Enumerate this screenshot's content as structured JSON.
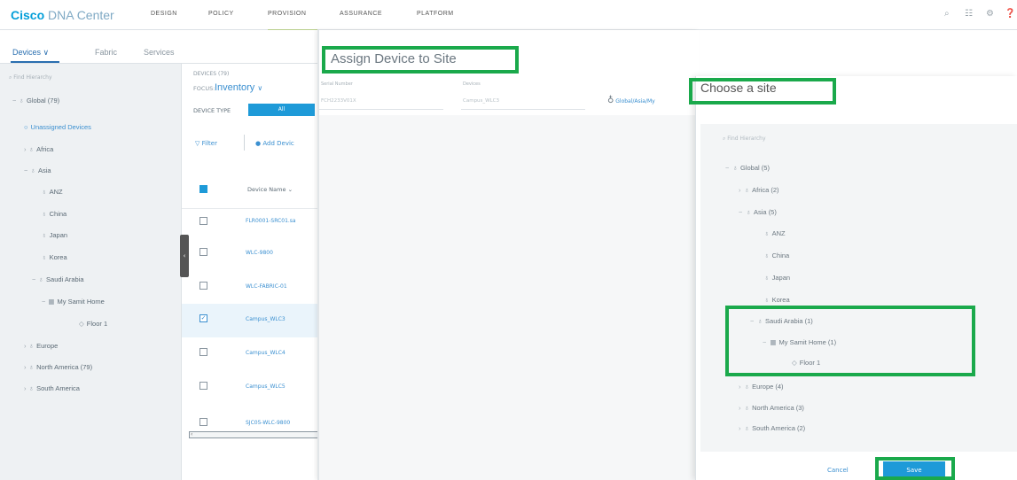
{
  "header": {
    "logo_bold": "Cisco",
    "logo_light": "DNA Center",
    "nav": [
      "DESIGN",
      "POLICY",
      "PROVISION",
      "ASSURANCE",
      "PLATFORM"
    ],
    "active_nav": "PROVISION",
    "icons": [
      "search-icon",
      "apps-icon",
      "gear-icon",
      "help-icon"
    ]
  },
  "subnav": {
    "tabs": [
      "Devices",
      "Fabric",
      "Services"
    ],
    "active": "Devices"
  },
  "sidebar": {
    "search_placeholder": "Find Hierarchy",
    "tree": [
      {
        "label": "Global (79)",
        "chev": "−",
        "icon": "globe-icon"
      },
      {
        "label": "Unassigned Devices",
        "icon": "unassigned-icon",
        "accent": true
      },
      {
        "label": "Africa",
        "chev": "›",
        "icon": "site-icon"
      },
      {
        "label": "Asia",
        "chev": "−",
        "icon": "site-icon"
      },
      {
        "label": "ANZ",
        "icon": "site-icon"
      },
      {
        "label": "China",
        "icon": "site-icon"
      },
      {
        "label": "Japan",
        "icon": "site-icon"
      },
      {
        "label": "Korea",
        "icon": "site-icon"
      },
      {
        "label": "Saudi Arabia",
        "chev": "−",
        "icon": "site-icon"
      },
      {
        "label": "My Samit Home",
        "chev": "−",
        "icon": "building-icon"
      },
      {
        "label": "Floor 1",
        "icon": "floor-icon"
      },
      {
        "label": "Europe",
        "chev": "›",
        "icon": "site-icon"
      },
      {
        "label": "North America (79)",
        "chev": "›",
        "icon": "site-icon"
      },
      {
        "label": "South America",
        "chev": "›",
        "icon": "site-icon"
      }
    ]
  },
  "devices": {
    "count_label": "DEVICES (79)",
    "focus_label": "FOCUS:",
    "focus_value": "Inventory",
    "device_type_label": "DEVICE TYPE",
    "device_type_value": "All",
    "filter_label": "Filter",
    "add_label": "Add Devic",
    "column_name": "Device Name",
    "rows": [
      {
        "name": "FLR0001-SRC01.sa",
        "checked": false
      },
      {
        "name": "WLC-9800",
        "checked": false
      },
      {
        "name": "WLC-FABRIC-01",
        "checked": false
      },
      {
        "name": "Campus_WLC3",
        "checked": true
      },
      {
        "name": "Campus_WLC4",
        "checked": false
      },
      {
        "name": "Campus_WLC5",
        "checked": false
      },
      {
        "name": "SJC05-WLC-9800",
        "checked": false
      }
    ]
  },
  "assign": {
    "title": "Assign Device to Site",
    "serial_label": "Serial Number",
    "serial_value": "FCH2233V01X",
    "devices_label": "Devices",
    "devices_value": "Campus_WLC3",
    "site_path": "Global/Asia/My"
  },
  "choose": {
    "title": "Choose a site",
    "search_placeholder": "Find Hierarchy",
    "tree": [
      {
        "label": "Global (5)",
        "chev": "−",
        "icon": "globe-icon"
      },
      {
        "label": "Africa (2)",
        "chev": "›",
        "icon": "site-icon"
      },
      {
        "label": "Asia (5)",
        "chev": "−",
        "icon": "site-icon"
      },
      {
        "label": "ANZ",
        "icon": "site-icon"
      },
      {
        "label": "China",
        "icon": "site-icon"
      },
      {
        "label": "Japan",
        "icon": "site-icon"
      },
      {
        "label": "Korea",
        "icon": "site-icon"
      },
      {
        "label": "Saudi Arabia (1)",
        "chev": "−",
        "icon": "site-icon"
      },
      {
        "label": "My Samit Home (1)",
        "chev": "−",
        "icon": "building-icon"
      },
      {
        "label": "Floor 1",
        "icon": "floor-icon"
      },
      {
        "label": "Europe (4)",
        "chev": "›",
        "icon": "site-icon"
      },
      {
        "label": "North America (3)",
        "chev": "›",
        "icon": "site-icon"
      },
      {
        "label": "South America (2)",
        "chev": "›",
        "icon": "site-icon"
      }
    ],
    "cancel_label": "Cancel",
    "save_label": "Save"
  },
  "colors": {
    "accent": "#1e9ad8",
    "highlight": "#1aa94b",
    "link": "#3a8fd0"
  }
}
